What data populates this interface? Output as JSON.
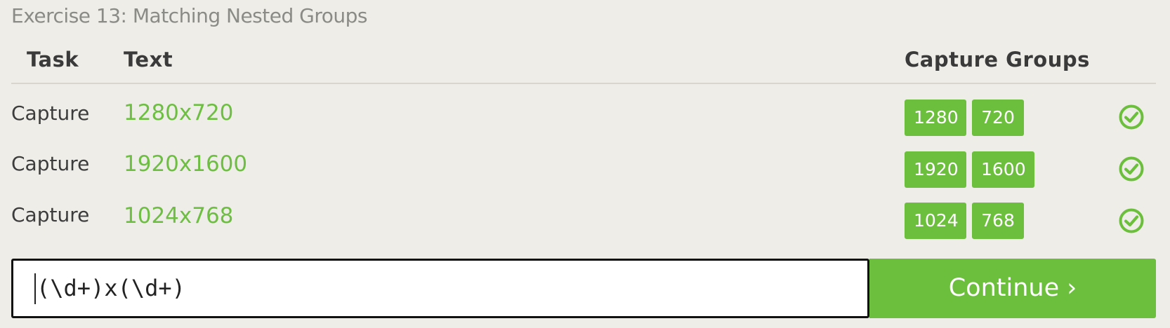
{
  "exercise": {
    "title": "Exercise 13: Matching Nested Groups"
  },
  "table": {
    "headers": {
      "task": "Task",
      "text": "Text",
      "groups": "Capture Groups"
    },
    "rows": [
      {
        "task": "Capture",
        "text": "1280x720",
        "groups": [
          "1280",
          "720"
        ],
        "status": "check-circle-icon"
      },
      {
        "task": "Capture",
        "text": "1920x1600",
        "groups": [
          "1920",
          "1600"
        ],
        "status": "check-circle-icon"
      },
      {
        "task": "Capture",
        "text": "1024x768",
        "groups": [
          "1024",
          "768"
        ],
        "status": "check-circle-icon"
      }
    ]
  },
  "input": {
    "value": "(\\d+)x(\\d+)"
  },
  "continue_button": {
    "label": "Continue ›"
  },
  "colors": {
    "accent_green": "#6cbf3d",
    "text_green": "#6dbe43",
    "background": "#efede8"
  }
}
